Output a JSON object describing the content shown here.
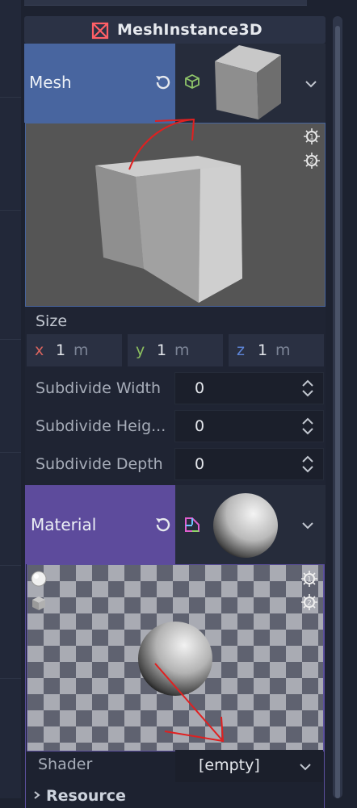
{
  "header": {
    "title": "MeshInstance3D",
    "icon": "mesh-instance-3d-icon",
    "icon_color": "#ff5f66"
  },
  "mesh": {
    "label": "Mesh",
    "label_bg": "#48659f",
    "reset_icon": "reload-icon",
    "resource_icon": "box-mesh-icon",
    "dropdown_icon": "chevron-down-icon",
    "size_label": "Size",
    "size": [
      {
        "axis": "x",
        "value": "1",
        "unit": "m",
        "color": "#d9645e"
      },
      {
        "axis": "y",
        "value": "1",
        "unit": "m",
        "color": "#8cc05f"
      },
      {
        "axis": "z",
        "value": "1",
        "unit": "m",
        "color": "#5e86d9"
      }
    ],
    "subdivide": [
      {
        "label": "Subdivide Width",
        "value": "0"
      },
      {
        "label": "Subdivide Heig...",
        "value": "0"
      },
      {
        "label": "Subdivide Depth",
        "value": "0"
      }
    ]
  },
  "material": {
    "label": "Material",
    "label_bg": "#5d4b9c",
    "reset_icon": "reload-icon",
    "resource_icon": "standard-material-icon",
    "dropdown_icon": "chevron-down-icon",
    "shader_label": "Shader",
    "shader_value": "[empty]",
    "resource_section": "Resource"
  }
}
